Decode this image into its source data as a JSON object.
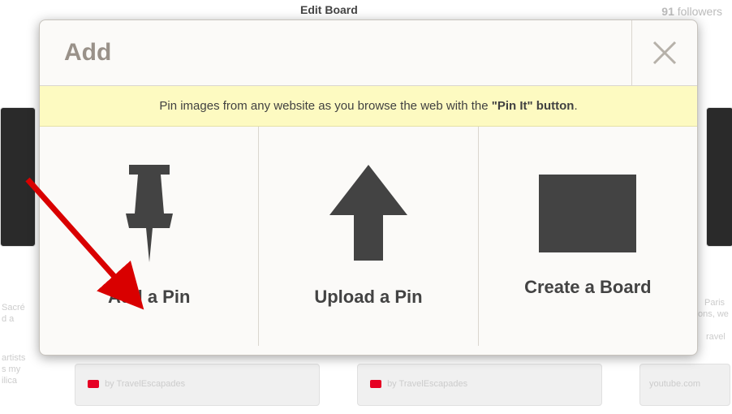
{
  "background": {
    "edit_board": "Edit Board",
    "followers_count": "91",
    "followers_label": "followers",
    "byline": "by TravelEscapades",
    "domain": "youtube.com",
    "sidebar_text_1": "Sacré",
    "sidebar_text_2": "d a",
    "sidebar_text_3": "artists",
    "sidebar_text_4": "s my",
    "sidebar_text_5": "ilica",
    "right_text_1": "Paris",
    "right_text_2": "ons, we",
    "right_text_3": "ravel"
  },
  "modal": {
    "title": "Add",
    "info_prefix": "Pin images from any website as you browse the web with the ",
    "info_bold": "\"Pin It\" button",
    "info_suffix": ".",
    "options": {
      "add_pin": "Add a Pin",
      "upload_pin": "Upload a Pin",
      "create_board": "Create a Board"
    }
  }
}
